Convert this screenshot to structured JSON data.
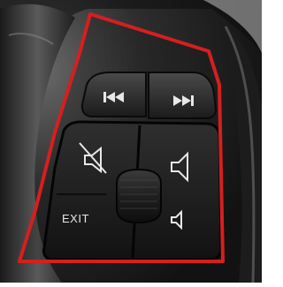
{
  "controls": {
    "exit_label": "EXIT",
    "highlight_color": "#d61f1f",
    "buttons": [
      {
        "name": "previous-track-button",
        "icon": "skip-back-icon"
      },
      {
        "name": "next-track-button",
        "icon": "skip-forward-icon"
      },
      {
        "name": "mute-button",
        "icon": "speaker-muted-icon"
      },
      {
        "name": "volume-up-button",
        "icon": "speaker-icon"
      },
      {
        "name": "volume-down-button",
        "icon": "speaker-small-icon"
      },
      {
        "name": "exit-button",
        "icon": ""
      },
      {
        "name": "thumbwheel-scroll",
        "icon": ""
      }
    ]
  }
}
